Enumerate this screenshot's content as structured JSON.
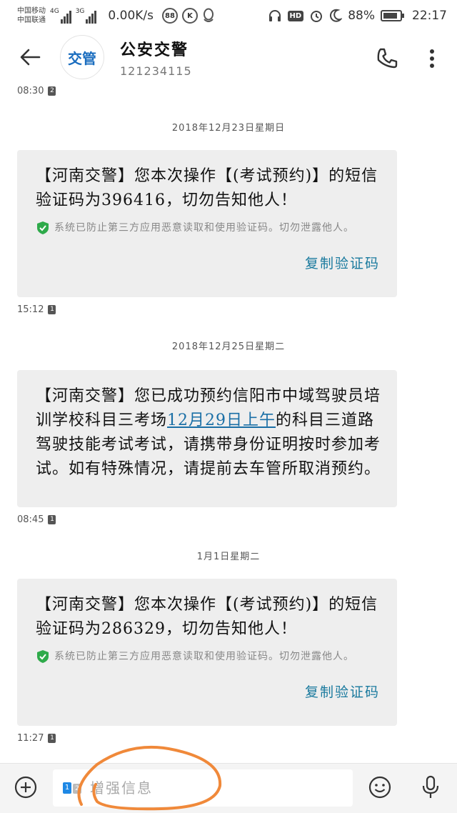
{
  "status_bar": {
    "carrier1": "中国移动",
    "carrier2": "中国联通",
    "net1": "4G",
    "net2": "3G",
    "speed": "0.00K/s",
    "badge1": "88",
    "badge2": "K",
    "battery": "88%",
    "battery_level": 0.88,
    "time": "22:17"
  },
  "header": {
    "avatar_text": "交管",
    "contact_name": "公安交警",
    "contact_number": "121234115"
  },
  "messages": [
    {
      "type": "time",
      "time": "08:30",
      "sim": "2"
    },
    {
      "type": "date",
      "date": "2018年12月23日星期日"
    },
    {
      "type": "bubble",
      "text": "【河南交警】您本次操作【(考试预约)】的短信验证码为396416，切勿告知他人！",
      "secure_note": "系统已防止第三方应用恶意读取和使用验证码。切勿泄露他人。",
      "copy_label": "复制验证码"
    },
    {
      "type": "time",
      "time": "15:12",
      "sim": "1"
    },
    {
      "type": "date",
      "date": "2018年12月25日星期二"
    },
    {
      "type": "bubble",
      "text_before": "【河南交警】您已成功预约信阳市中域驾驶员培训学校科目三考场",
      "link": "12月29日上午",
      "text_after": "的科目三道路驾驶技能考试考试，请携带身份证明按时参加考试。如有特殊情况，请提前去车管所取消预约。"
    },
    {
      "type": "time",
      "time": "08:45",
      "sim": "1"
    },
    {
      "type": "date",
      "date": "1月1日星期二"
    },
    {
      "type": "bubble",
      "text": "【河南交警】您本次操作【(考试预约)】的短信验证码为286329，切勿告知他人！",
      "secure_note": "系统已防止第三方应用恶意读取和使用验证码。切勿泄露他人。",
      "copy_label": "复制验证码"
    },
    {
      "type": "time",
      "time": "11:27",
      "sim": "1"
    }
  ],
  "composer": {
    "placeholder": "增强信息",
    "sim_active": "1",
    "sim_inactive": "2"
  },
  "colors": {
    "link": "#1a6fa6",
    "copy": "#1a7a9e",
    "bubble_bg": "#eeeeee",
    "shield": "#2eaa4a",
    "annotation": "#f0893a"
  },
  "icons": [
    "back-arrow-icon",
    "phone-icon",
    "more-vertical-icon",
    "shield-check-icon",
    "add-icon",
    "emoji-icon",
    "microphone-icon"
  ]
}
